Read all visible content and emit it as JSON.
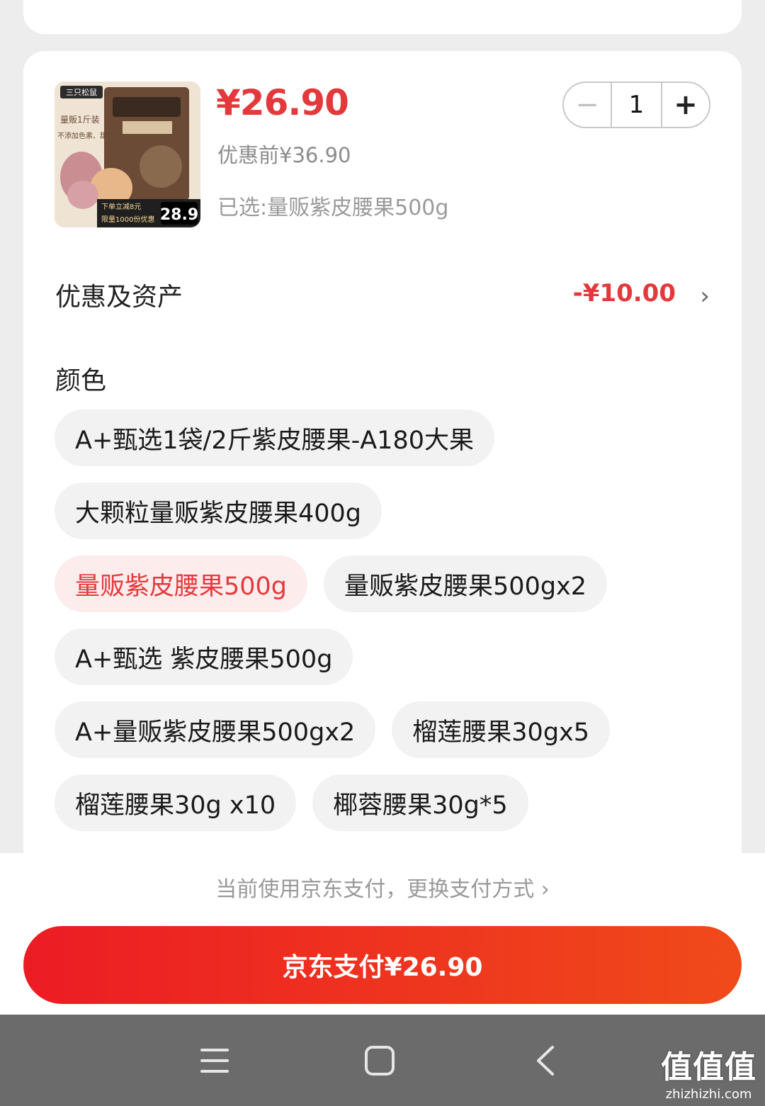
{
  "product": {
    "price": "¥26.90",
    "original_price": "优惠前¥36.90",
    "selected_spec": "已选:量贩紫皮腰果500g",
    "thumbnail": {
      "brand": "三只松鼠",
      "badge": "量贩1斤装",
      "note": "不添加色素、甜味剂",
      "promo_line1": "下单立减8元",
      "promo_line2": "限量1000份优惠",
      "promo_price": "28.9"
    }
  },
  "quantity": {
    "minus": "−",
    "value": "1",
    "plus": "+"
  },
  "coupon": {
    "label": "优惠及资产",
    "value": "-¥10.00",
    "chevron": "›"
  },
  "spec_section": {
    "title": "颜色",
    "rows": [
      [
        {
          "label": "A+甄选1袋/2斤紫皮腰果-A180大果",
          "active": false
        }
      ],
      [
        {
          "label": "大颗粒量贩紫皮腰果400g",
          "active": false
        }
      ],
      [
        {
          "label": "量贩紫皮腰果500g",
          "active": true
        },
        {
          "label": "量贩紫皮腰果500gx2",
          "active": false
        }
      ],
      [
        {
          "label": "A+甄选 紫皮腰果500g",
          "active": false
        }
      ],
      [
        {
          "label": "A+量贩紫皮腰果500gx2",
          "active": false
        },
        {
          "label": "榴莲腰果30gx5",
          "active": false
        }
      ],
      [
        {
          "label": "榴莲腰果30g x10",
          "active": false
        },
        {
          "label": "椰蓉腰果30g*5",
          "active": false
        }
      ]
    ]
  },
  "payment": {
    "hint": "当前使用京东支付，更换支付方式 ›",
    "button": "京东支付¥26.90"
  },
  "nav": {
    "icons": [
      "menu-icon",
      "home-icon",
      "back-icon"
    ]
  },
  "watermark": {
    "main": "值值值",
    "url": "zhizhizhi.com"
  },
  "colors": {
    "accent": "#e4393c",
    "pay_start": "#ec1c24",
    "pay_end": "#f04a1a"
  }
}
